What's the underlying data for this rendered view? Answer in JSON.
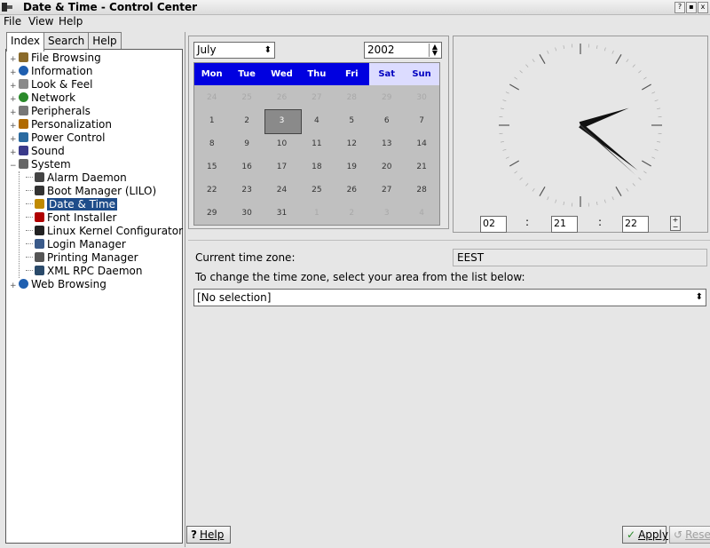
{
  "window": {
    "title": "Date & Time - Control Center"
  },
  "menu": [
    "File",
    "View",
    "Help"
  ],
  "tabs": [
    "Index",
    "Search",
    "Help"
  ],
  "tree": [
    {
      "label": "File Browsing",
      "icon": "folder-icon",
      "expandable": true
    },
    {
      "label": "Information",
      "icon": "info-icon",
      "expandable": true
    },
    {
      "label": "Look & Feel",
      "icon": "brush-icon",
      "expandable": true
    },
    {
      "label": "Network",
      "icon": "globe-icon",
      "expandable": true
    },
    {
      "label": "Peripherals",
      "icon": "peripherals-icon",
      "expandable": true
    },
    {
      "label": "Personalization",
      "icon": "person-icon",
      "expandable": true
    },
    {
      "label": "Power Control",
      "icon": "power-icon",
      "expandable": true
    },
    {
      "label": "Sound",
      "icon": "speaker-icon",
      "expandable": true
    },
    {
      "label": "System",
      "icon": "wrench-icon",
      "expandable": true
    },
    {
      "label": "Alarm Daemon",
      "icon": "alarm-icon",
      "child": true
    },
    {
      "label": "Boot Manager (LILO)",
      "icon": "boot-icon",
      "child": true
    },
    {
      "label": "Date & Time",
      "icon": "calendar-icon",
      "child": true,
      "selected": true
    },
    {
      "label": "Font Installer",
      "icon": "font-icon",
      "child": true
    },
    {
      "label": "Linux Kernel Configurator",
      "icon": "kernel-icon",
      "child": true
    },
    {
      "label": "Login Manager",
      "icon": "login-icon",
      "child": true
    },
    {
      "label": "Printing Manager",
      "icon": "printer-icon",
      "child": true
    },
    {
      "label": "XML RPC Daemon",
      "icon": "rpc-icon",
      "child": true
    },
    {
      "label": "Web Browsing",
      "icon": "web-icon",
      "expandable": true
    }
  ],
  "calendar": {
    "month": "July",
    "year": "2002",
    "day_names": [
      "Mon",
      "Tue",
      "Wed",
      "Thu",
      "Fri",
      "Sat",
      "Sun"
    ],
    "weeks": [
      [
        {
          "d": "24",
          "dim": true
        },
        {
          "d": "25",
          "dim": true
        },
        {
          "d": "26",
          "dim": true
        },
        {
          "d": "27",
          "dim": true
        },
        {
          "d": "28",
          "dim": true
        },
        {
          "d": "29",
          "dim": true
        },
        {
          "d": "30",
          "dim": true
        }
      ],
      [
        {
          "d": "1"
        },
        {
          "d": "2"
        },
        {
          "d": "3",
          "today": true
        },
        {
          "d": "4"
        },
        {
          "d": "5"
        },
        {
          "d": "6"
        },
        {
          "d": "7"
        }
      ],
      [
        {
          "d": "8"
        },
        {
          "d": "9"
        },
        {
          "d": "10"
        },
        {
          "d": "11"
        },
        {
          "d": "12"
        },
        {
          "d": "13"
        },
        {
          "d": "14"
        }
      ],
      [
        {
          "d": "15"
        },
        {
          "d": "16"
        },
        {
          "d": "17"
        },
        {
          "d": "18"
        },
        {
          "d": "19"
        },
        {
          "d": "20"
        },
        {
          "d": "21"
        }
      ],
      [
        {
          "d": "22"
        },
        {
          "d": "23"
        },
        {
          "d": "24"
        },
        {
          "d": "25"
        },
        {
          "d": "26"
        },
        {
          "d": "27"
        },
        {
          "d": "28"
        }
      ],
      [
        {
          "d": "29"
        },
        {
          "d": "30"
        },
        {
          "d": "31"
        },
        {
          "d": "1",
          "dim": true
        },
        {
          "d": "2",
          "dim": true
        },
        {
          "d": "3",
          "dim": true
        },
        {
          "d": "4",
          "dim": true
        }
      ]
    ],
    "colors": {
      "header": "#0000e0",
      "weekend_bg": "#dcdcff",
      "grid_bg": "#c0c0c0"
    }
  },
  "time": {
    "hours": "02",
    "minutes": "21",
    "seconds": "22",
    "separator": ":"
  },
  "timezone": {
    "label": "Current time zone:",
    "value": "EEST",
    "instruction": "To change the time zone, select your area from the list below:",
    "selection": "[No selection]"
  },
  "buttons": {
    "help": "Help",
    "apply": "Apply",
    "reset": "Reset"
  }
}
